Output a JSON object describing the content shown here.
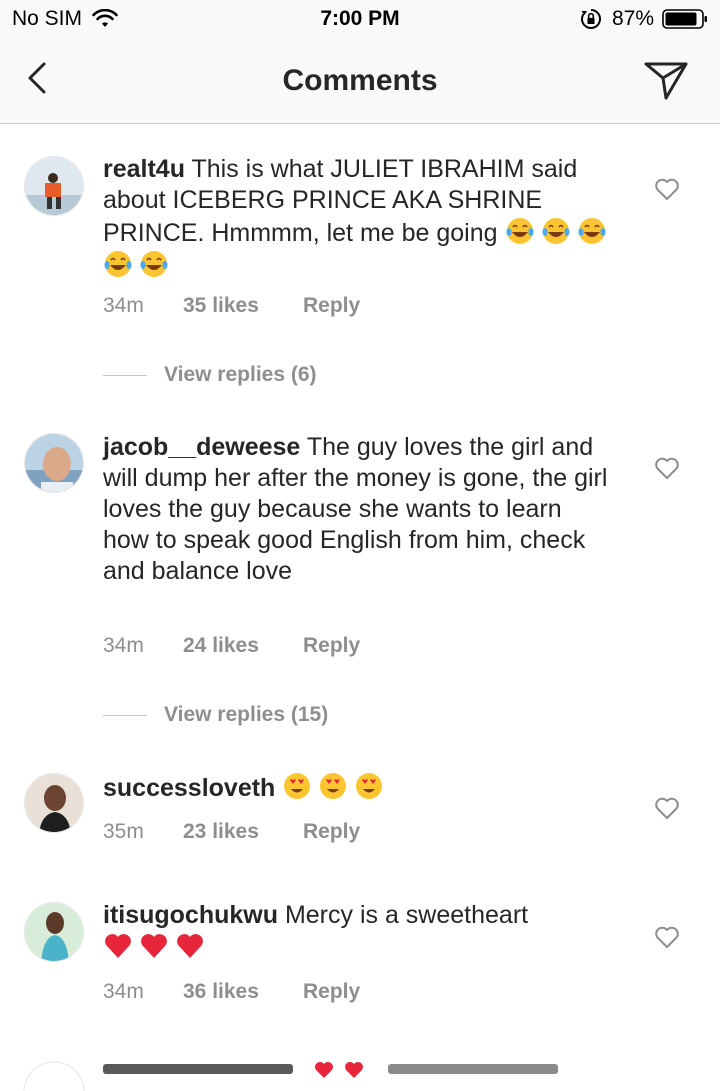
{
  "status_bar": {
    "carrier": "No SIM",
    "time": "7:00 PM",
    "battery": "87%"
  },
  "nav": {
    "title": "Comments"
  },
  "comments": [
    {
      "username": "realt4u",
      "text": "This is what JULIET IBRAHIM said about ICEBERG PRINCE AKA SHRINE PRINCE. Hmmmm, let me be going",
      "emojis": [
        "laughing-crying",
        "laughing-crying",
        "laughing-crying",
        "laughing-crying",
        "laughing-crying"
      ],
      "time": "34m",
      "likes": "35 likes",
      "reply": "Reply",
      "view_replies": "View replies (6)"
    },
    {
      "username": "jacob__deweese",
      "text": "The guy loves the girl and will dump her after the money is gone, the girl loves the guy because she wants to learn how to speak good English from him, check and balance love",
      "time": "34m",
      "likes": "24 likes",
      "reply": "Reply",
      "view_replies": "View replies (15)"
    },
    {
      "username": "successloveth",
      "text": "",
      "emojis": [
        "heart-eyes",
        "heart-eyes",
        "heart-eyes"
      ],
      "time": "35m",
      "likes": "23 likes",
      "reply": "Reply"
    },
    {
      "username": "itisugochukwu",
      "text": "Mercy is a sweetheart",
      "emojis": [
        "red-heart",
        "red-heart",
        "red-heart"
      ],
      "time": "34m",
      "likes": "36 likes",
      "reply": "Reply"
    }
  ],
  "colors": {
    "text": "#262626",
    "meta": "#8e8e8e",
    "bar": "#f9f9f9"
  }
}
